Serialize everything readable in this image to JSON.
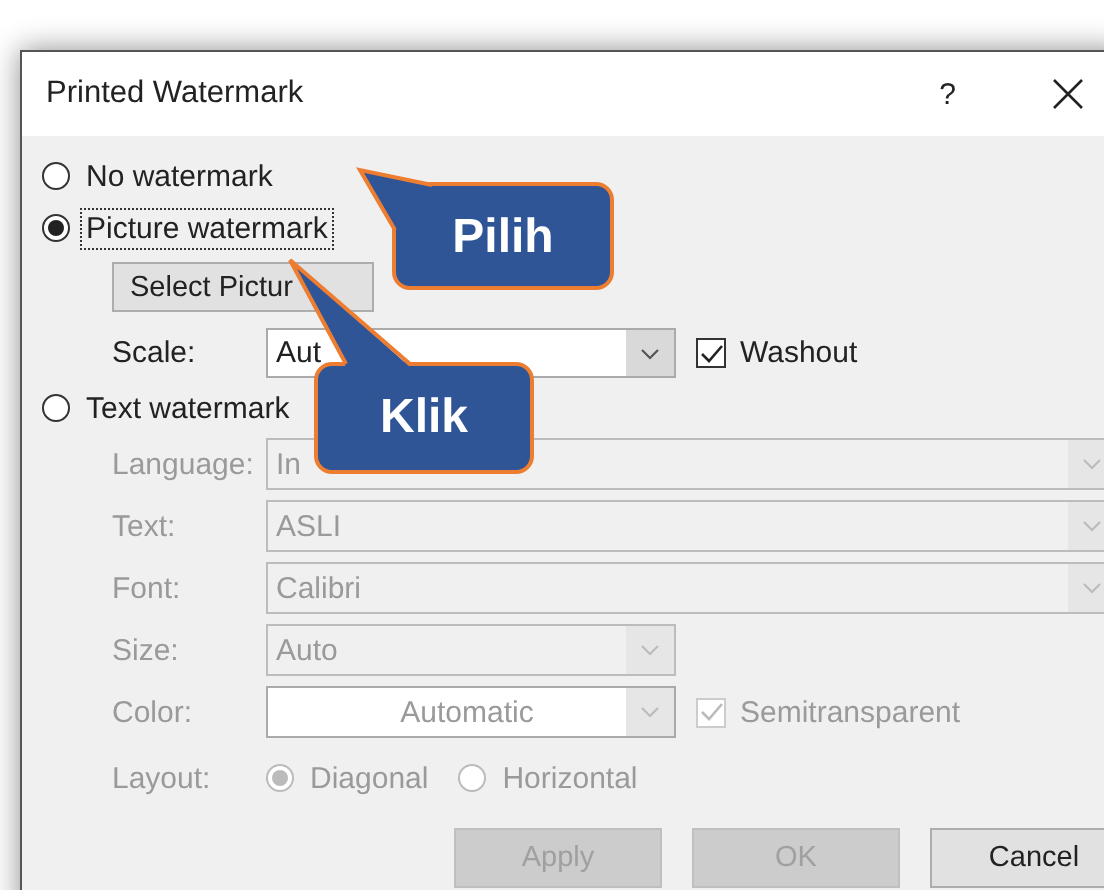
{
  "window": {
    "title": "Printed Watermark",
    "help": "?"
  },
  "watermark_options": [
    {
      "label": "No watermark",
      "selected": false
    },
    {
      "label": "Picture watermark",
      "selected": true
    }
  ],
  "picture": {
    "button": "Select Pictur",
    "scale": {
      "label": "Scale:",
      "value": "Aut"
    },
    "washout": {
      "label": "Washout",
      "checked": true
    }
  },
  "text_option": {
    "label": "Text watermark",
    "selected": false
  },
  "text_fields": [
    {
      "label": "Language:",
      "value": "In",
      "kind": "wide"
    },
    {
      "label": "Text:",
      "value": "ASLI",
      "kind": "wide"
    },
    {
      "label": "Font:",
      "value": "Calibri",
      "kind": "wide"
    },
    {
      "label": "Size:",
      "value": "Auto",
      "kind": "narrow"
    },
    {
      "label": "Color:",
      "value": "Automatic",
      "kind": "color"
    }
  ],
  "semitransparent": {
    "label": "Semitransparent",
    "checked": true,
    "disabled": true
  },
  "layout": {
    "label": "Layout:",
    "options": [
      {
        "label": "Diagonal",
        "selected": true
      },
      {
        "label": "Horizontal",
        "selected": false
      }
    ]
  },
  "buttons": [
    {
      "label": "Apply",
      "disabled": true
    },
    {
      "label": "OK",
      "disabled": true
    },
    {
      "label": "Cancel",
      "disabled": false
    }
  ],
  "callouts": [
    {
      "text": "Pilih"
    },
    {
      "text": "Klik"
    }
  ]
}
